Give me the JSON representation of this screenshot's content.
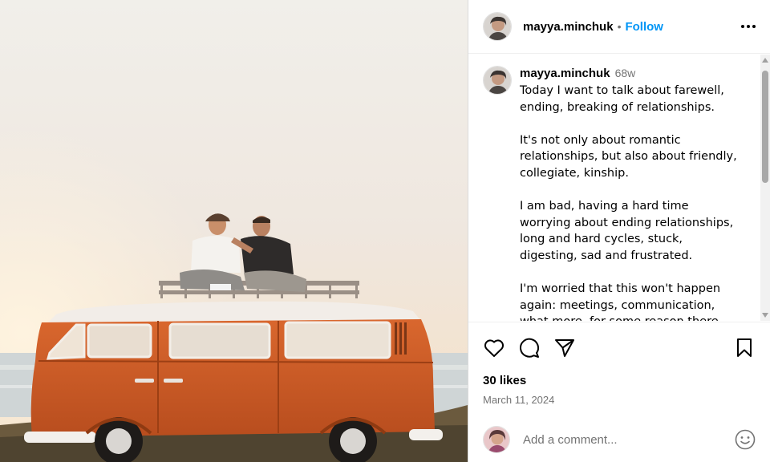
{
  "post": {
    "image_alt": "Two men sitting on the roof of an orange van at sunset",
    "author": {
      "username": "mayya.minchuk",
      "avatar_icon": "user-avatar"
    },
    "follow_label": "Follow",
    "separator": "•",
    "caption": {
      "username": "mayya.minchuk",
      "time_ago": "68w",
      "text": "Today I want to talk about farewell, ending, breaking of relationships.\n\nIt's not only about romantic relationships, but also about friendly, collegiate, kinship.\n\nI am bad, having a hard time worrying about ending relationships, long and hard cycles, stuck, digesting, sad and frustrated.\n\nI'm worried that this won't happen again: meetings, communication, what more, for some reason there won't be"
    },
    "likes": "30 likes",
    "date": "March 11, 2024",
    "comment_placeholder": "Add a comment...",
    "icons": {
      "like": "heart-icon",
      "comment": "comment-icon",
      "share": "share-icon",
      "save": "bookmark-icon",
      "more": "more-icon",
      "emoji": "emoji-icon"
    },
    "colors": {
      "link": "#0095f6",
      "muted": "#737373",
      "van": "#d0602a"
    }
  }
}
